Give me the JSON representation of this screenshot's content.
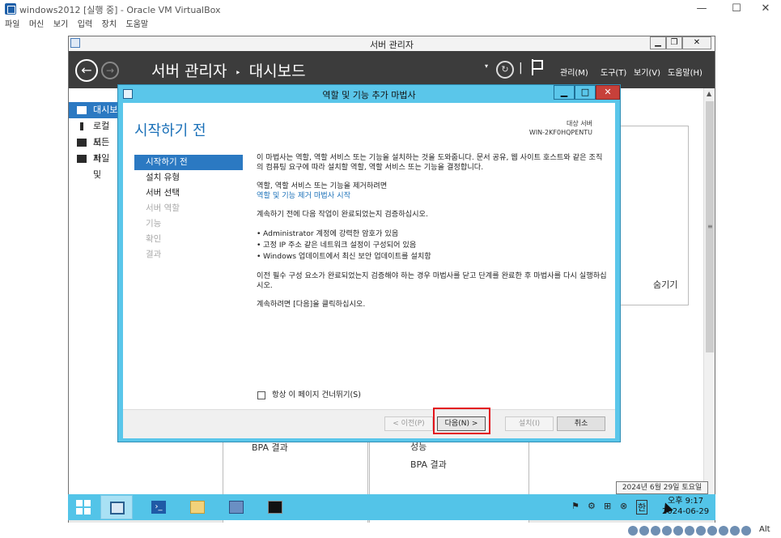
{
  "vbox": {
    "title": "windows2012 [실행 중] - Oracle VM VirtualBox",
    "menu": [
      "파일",
      "머신",
      "보기",
      "입력",
      "장치",
      "도움말"
    ],
    "window_controls": [
      "—",
      "☐",
      "✕"
    ],
    "status_host_key": "Alt"
  },
  "server_manager": {
    "window_title": "서버 관리자",
    "breadcrumb_root": "서버 관리자",
    "breadcrumb_sep": "‣",
    "breadcrumb_page": "대시보드",
    "header_menu": [
      "관리(M)",
      "도구(T)",
      "보기(V)",
      "도움말(H)"
    ],
    "sidebar": [
      {
        "label": "대시보드",
        "icon": "dashboard-icon",
        "active": true
      },
      {
        "label": "로컬 서버",
        "icon": "local-server-icon"
      },
      {
        "label": "모든 서버",
        "icon": "all-servers-icon"
      },
      {
        "label": "파일 및 저장소 서비스",
        "icon": "file-storage-icon"
      }
    ],
    "background_texts": {
      "hide": "숨기기",
      "bpa_left": "BPA 결과",
      "performance": "성능",
      "bpa_right": "BPA 결과"
    },
    "sidebar_visible_text": [
      "대시보",
      "로컬 서",
      "모든 서",
      "파일 및"
    ]
  },
  "wizard": {
    "title": "역할 및 기능 추가 마법사",
    "heading": "시작하기 전",
    "target_label": "대상 서버",
    "target_server": "WIN-2KF0HQPENTU",
    "steps": [
      {
        "label": "시작하기 전",
        "state": "active"
      },
      {
        "label": "설치 유형",
        "state": "enabled"
      },
      {
        "label": "서버 선택",
        "state": "enabled"
      },
      {
        "label": "서버 역할",
        "state": "disabled"
      },
      {
        "label": "기능",
        "state": "disabled"
      },
      {
        "label": "확인",
        "state": "disabled"
      },
      {
        "label": "결과",
        "state": "disabled"
      }
    ],
    "intro": "이 마법사는 역할, 역할 서비스 또는 기능을 설치하는 것을 도와줍니다. 문서 공유, 웹 사이트 호스트와 같은 조직의 컴퓨팅 요구에 따라 설치할 역할, 역할 서비스 또는 기능을 결정합니다.",
    "remove_text": "역할, 역할 서비스 또는 기능을 제거하려면",
    "remove_link": "역할 및 기능 제거 마법사 시작",
    "verify_text": "계속하기 전에 다음 작업이 완료되었는지 검증하십시오.",
    "bullets": [
      "Administrator 계정에 강력한 암호가 있음",
      "고정 IP 주소 같은 네트워크 설정이 구성되어 있음",
      "Windows 업데이트에서 최신 보안 업데이트를 설치함"
    ],
    "prereq_text": "이전 필수 구성 요소가 완료되었는지 검증해야 하는 경우 마법사를 닫고 단계를 완료한 후 마법사를 다시 실행하십시오.",
    "continue_text": "계속하려면 [다음]을 클릭하십시오.",
    "skip_label": "항상 이 페이지 건너뛰기(S)",
    "buttons": {
      "prev": "< 이전(P)",
      "next": "다음(N) >",
      "install": "설치(I)",
      "cancel": "취소"
    }
  },
  "taskbar": {
    "apps": [
      "start-icon",
      "server-manager-icon",
      "powershell-icon",
      "file-explorer-icon",
      "network-icon",
      "cmd-icon"
    ],
    "ime": "한",
    "time": "오후 9:17",
    "date": "2024-06-29",
    "date_tooltip": "2024년 6월 29일 토요일"
  },
  "colors": {
    "accent": "#2b79c2",
    "wizard_frame": "#5ac6ea",
    "taskbar": "#53c4e8",
    "header_dark": "#3c3c3c",
    "highlight": "#e3141b"
  }
}
